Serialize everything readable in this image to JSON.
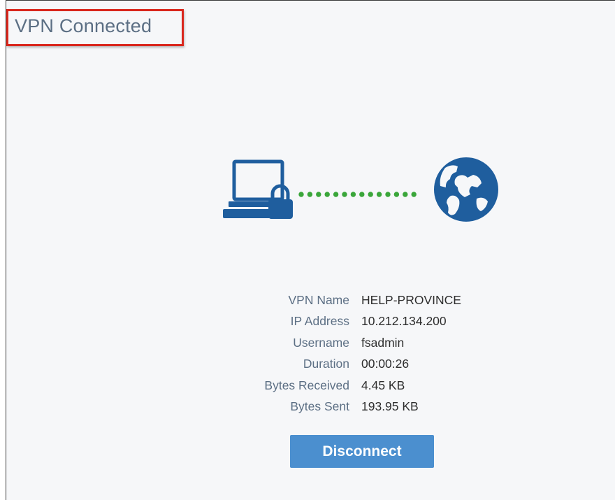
{
  "header": {
    "title": "VPN Connected"
  },
  "illustration": {
    "left_icon": "computer-lock-icon",
    "connector": "dotted-connection-line",
    "right_icon": "globe-icon",
    "icon_color": "#1f5e9e",
    "dot_color": "#3aa63a"
  },
  "details": [
    {
      "label": "VPN Name",
      "value": "HELP-PROVINCE"
    },
    {
      "label": "IP Address",
      "value": "10.212.134.200"
    },
    {
      "label": "Username",
      "value": "fsadmin"
    },
    {
      "label": "Duration",
      "value": "00:00:26"
    },
    {
      "label": "Bytes Received",
      "value": "4.45 KB"
    },
    {
      "label": "Bytes Sent",
      "value": "193.95 KB"
    }
  ],
  "actions": {
    "disconnect_label": "Disconnect"
  },
  "colors": {
    "accent": "#4b8fcf",
    "label_text": "#5c6f84",
    "highlight_border": "#d9261c",
    "background": "#f6f7f9"
  }
}
